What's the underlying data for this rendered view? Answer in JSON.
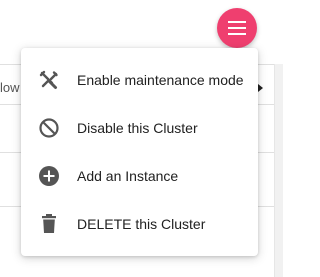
{
  "table": {
    "partial_header": "low"
  },
  "fab": {
    "icon": "menu-icon",
    "color": "#ef3f6f"
  },
  "menu": {
    "items": [
      {
        "label": "Enable maintenance mode",
        "icon": "wrench-tools-icon"
      },
      {
        "label": "Disable this Cluster",
        "icon": "block-icon"
      },
      {
        "label": "Add an Instance",
        "icon": "add-circle-icon"
      },
      {
        "label": "DELETE this Cluster",
        "icon": "trash-icon"
      }
    ]
  }
}
